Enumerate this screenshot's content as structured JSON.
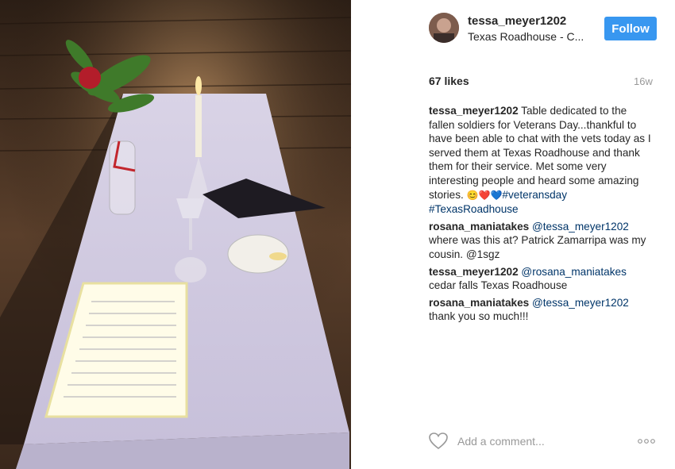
{
  "post": {
    "username": "tessa_meyer1202",
    "location": "Texas Roadhouse - C...",
    "follow_label": "Follow",
    "likes": "67 likes",
    "age": "16w",
    "caption_user": "tessa_meyer1202",
    "caption_text": " Table dedicated to the fallen soldiers for Veterans Day...thankful to have been able to chat with the vets today as I served them at Texas Roadhouse and thank them for their service. Met some very interesting people and heard some amazing stories. ",
    "caption_emoji": "😊❤️💙",
    "caption_tag1": "#veteransday",
    "caption_tag2": "#TexasRoadhouse"
  },
  "comments": [
    {
      "user": "rosana_maniatakes",
      "mention": "@tessa_meyer1202",
      "text": " where was this at? Patrick Zamarripa was my cousin. @1sgz"
    },
    {
      "user": "tessa_meyer1202",
      "mention": "@rosana_maniatakes",
      "text": " cedar falls Texas Roadhouse"
    },
    {
      "user": "rosana_maniatakes",
      "mention": "@tessa_meyer1202",
      "text": " thank you so much!!!"
    }
  ],
  "footer": {
    "add_comment_placeholder": "Add a comment..."
  },
  "icons": [
    "heart-icon",
    "more-options-icon"
  ],
  "colors": {
    "follow": "#3897f0",
    "link": "#003569",
    "muted": "#999999"
  }
}
